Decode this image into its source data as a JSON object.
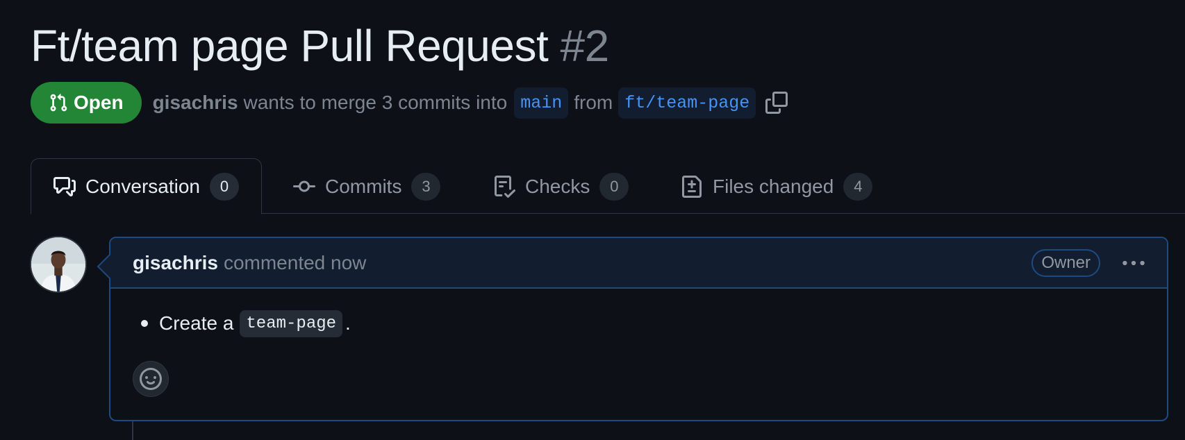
{
  "pr": {
    "title": "Ft/team page Pull Request",
    "number": "#2",
    "state": "Open",
    "author": "gisachris",
    "merge_text": "wants to merge 3 commits into",
    "base_branch": "main",
    "from_text": "from",
    "head_branch": "ft/team-page"
  },
  "tabs": [
    {
      "label": "Conversation",
      "count": "0",
      "icon": "comment-discussion-icon",
      "selected": true
    },
    {
      "label": "Commits",
      "count": "3",
      "icon": "git-commit-icon",
      "selected": false
    },
    {
      "label": "Checks",
      "count": "0",
      "icon": "checklist-icon",
      "selected": false
    },
    {
      "label": "Files changed",
      "count": "4",
      "icon": "file-diff-icon",
      "selected": false
    }
  ],
  "comment": {
    "author": "gisachris",
    "action": "commented now",
    "role_badge": "Owner",
    "body_prefix": "Create a",
    "body_code": "team-page",
    "body_suffix": "."
  },
  "colors": {
    "background": "#0d1117",
    "open_badge": "#238636",
    "branch_link": "#4493f8",
    "comment_border": "#1f4a80",
    "comment_header": "#121d2f"
  }
}
